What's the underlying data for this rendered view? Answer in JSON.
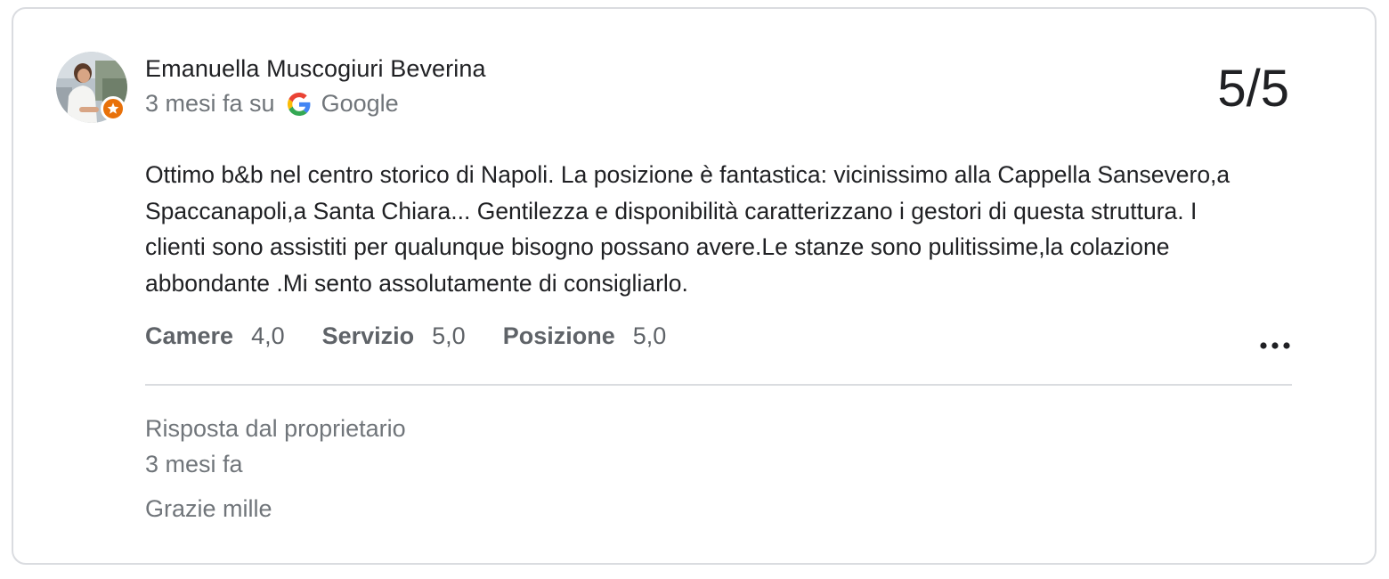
{
  "review": {
    "author": "Emanuella Muscogiuri Beverina",
    "time": "3 mesi fa su",
    "source": "Google",
    "score": "5/5",
    "text": "Ottimo b&b nel centro storico di Napoli. La posizione è fantastica: vicinissimo alla Cappella Sansevero,a Spaccanapoli,a Santa Chiara... Gentilezza e disponibilità caratterizzano i gestori di questa struttura. I clienti sono assistiti per qualunque bisogno possano avere.Le stanze sono pulitissime,la colazione abbondante .Mi sento assolutamente di consigliarlo.",
    "ratings": [
      {
        "label": "Camere",
        "value": "4,0"
      },
      {
        "label": "Servizio",
        "value": "5,0"
      },
      {
        "label": "Posizione",
        "value": "5,0"
      }
    ],
    "avatar_icon": "user-photo",
    "badge_icon": "local-guide-star-icon",
    "badge_color": "#e8710a",
    "more_icon": "more-horizontal-icon"
  },
  "owner_response": {
    "label": "Risposta dal proprietario",
    "time": "3 mesi fa",
    "text": "Grazie mille"
  }
}
